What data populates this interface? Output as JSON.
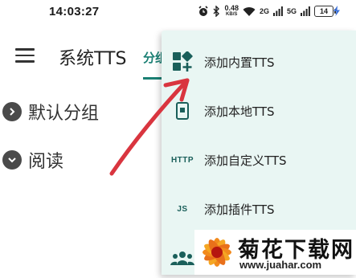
{
  "status_bar": {
    "time": "14:03:27",
    "net_speed": "0.48",
    "net_speed_unit": "KB/S",
    "signal_1_label": "2G",
    "signal_2_label": "5G",
    "battery_level": "14"
  },
  "app_bar": {
    "title": "系统TTS",
    "tab_fragment": "分组"
  },
  "groups": [
    {
      "label": "默认分组",
      "expanded": false
    },
    {
      "label": "阅读",
      "expanded": true
    }
  ],
  "menu": {
    "items": [
      {
        "label": "添加内置TTS",
        "icon": "grid-add-icon"
      },
      {
        "label": "添加本地TTS",
        "icon": "local-device-icon"
      },
      {
        "label": "添加自定义TTS",
        "icon": "http-icon",
        "icon_text": "HTTP"
      },
      {
        "label": "添加插件TTS",
        "icon": "js-icon",
        "icon_text": "JS"
      },
      {
        "label": "",
        "icon": "group-people-icon"
      }
    ]
  },
  "watermark": {
    "title": "菊花下载网",
    "url": "www.juahar.com"
  },
  "colors": {
    "accent": "#1a7f73",
    "menu_bg": "#e9f6f3",
    "arrow": "#d9353f"
  }
}
